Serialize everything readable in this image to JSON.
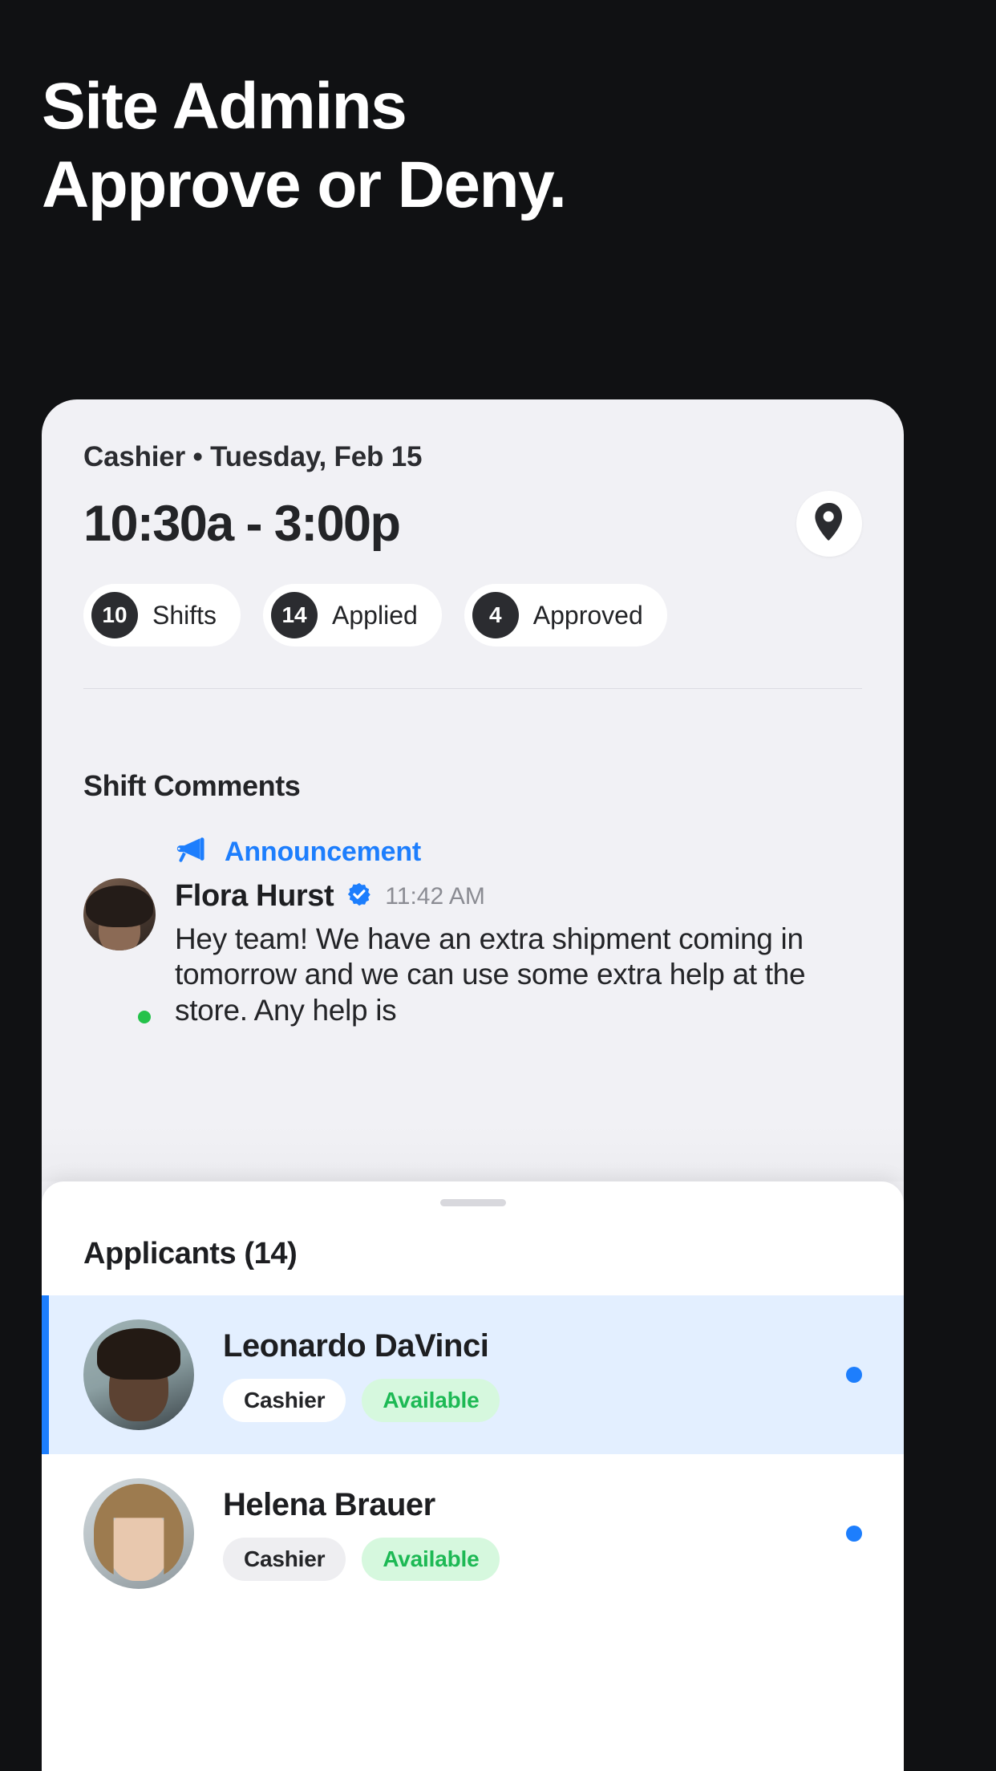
{
  "headline": {
    "line1": "Site Admins",
    "line2": "Approve or Deny."
  },
  "shift": {
    "meta": "Cashier • Tuesday, Feb 15",
    "time_range": "10:30a - 3:00p",
    "location_icon": "map-pin-icon",
    "stats": [
      {
        "count": "10",
        "label": "Shifts"
      },
      {
        "count": "14",
        "label": "Applied"
      },
      {
        "count": "4",
        "label": "Approved"
      }
    ]
  },
  "comments": {
    "section_title": "Shift Comments",
    "announcement_icon": "megaphone-icon",
    "announcement_label": "Announcement",
    "author": "Flora Hurst",
    "verified_icon": "verified-badge-icon",
    "timestamp": "11:42 AM",
    "text": "Hey team! We have an extra shipment coming in tomorrow and we can use some extra help at the store. Any help is"
  },
  "applicants_sheet": {
    "title": "Applicants (14)",
    "rows": [
      {
        "name": "Leonardo DaVinci",
        "role": "Cashier",
        "availability": "Available",
        "selected": true
      },
      {
        "name": "Helena Brauer",
        "role": "Cashier",
        "availability": "Available",
        "selected": false
      }
    ]
  },
  "colors": {
    "background": "#101113",
    "card": "#f1f1f5",
    "accent_blue": "#1d7efd",
    "available_green": "#1db954",
    "dark": "#232427"
  }
}
